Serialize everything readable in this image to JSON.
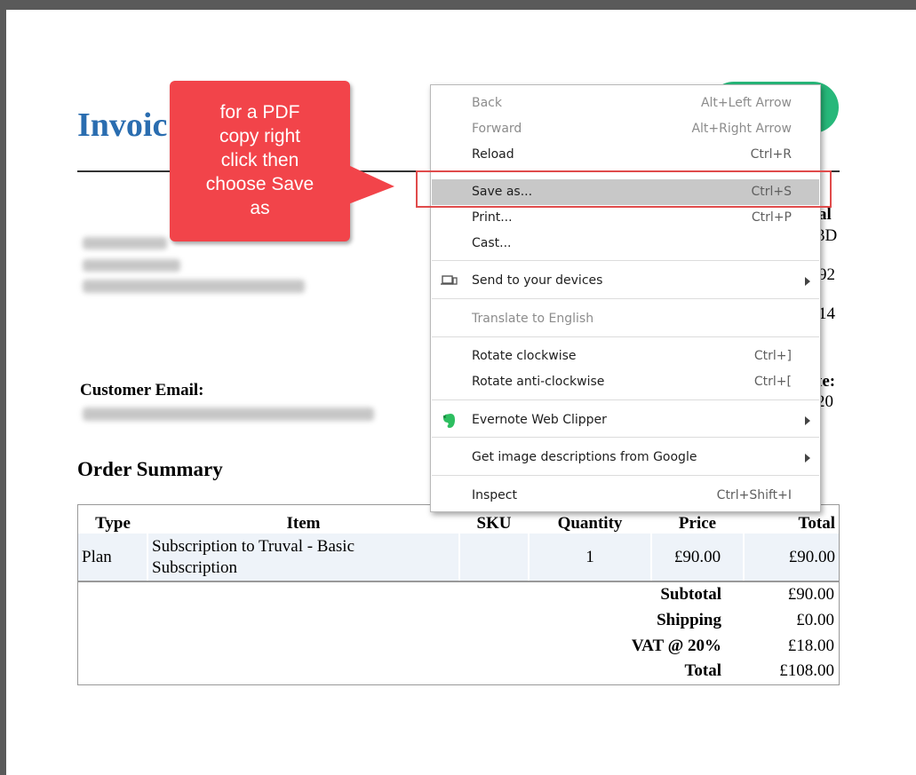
{
  "invoice": {
    "title_fragment": "Invoic",
    "right_fragments": [
      "al",
      "3D",
      "92",
      "14",
      "te:",
      "20"
    ],
    "customer_email_label": "Customer Email:",
    "order_summary_heading": "Order Summary",
    "table": {
      "headers": [
        "Type",
        "Item",
        "SKU",
        "Quantity",
        "Price",
        "Total"
      ],
      "rows": [
        {
          "type": "Plan",
          "item": "Subscription to Truval - Basic Subscription",
          "sku": "",
          "quantity": "1",
          "price": "£90.00",
          "total": "£90.00"
        }
      ]
    },
    "totals": [
      {
        "label": "Subtotal",
        "value": "£90.00"
      },
      {
        "label": "Shipping",
        "value": "£0.00"
      },
      {
        "label": "VAT @ 20%",
        "value": "£18.00"
      },
      {
        "label": "Total",
        "value": "£108.00"
      }
    ]
  },
  "callout": {
    "lines": [
      "for a PDF",
      "copy right",
      "click then",
      "choose Save",
      "as"
    ],
    "color": "#f2444a"
  },
  "context_menu": {
    "items": [
      {
        "label": "Back",
        "shortcut": "Alt+Left Arrow",
        "disabled": true
      },
      {
        "label": "Forward",
        "shortcut": "Alt+Right Arrow",
        "disabled": true
      },
      {
        "label": "Reload",
        "shortcut": "Ctrl+R"
      },
      {
        "label": "Save as...",
        "shortcut": "Ctrl+S",
        "highlighted": true
      },
      {
        "label": "Print...",
        "shortcut": "Ctrl+P"
      },
      {
        "label": "Cast..."
      },
      {
        "label": "Send to your devices",
        "icon": "devices-icon",
        "submenu": true
      },
      {
        "label": "Translate to English",
        "disabled": true
      },
      {
        "label": "Rotate clockwise",
        "shortcut": "Ctrl+]"
      },
      {
        "label": "Rotate anti-clockwise",
        "shortcut": "Ctrl+["
      },
      {
        "label": "Evernote Web Clipper",
        "icon": "evernote-icon",
        "submenu": true
      },
      {
        "label": "Get image descriptions from Google",
        "submenu": true
      },
      {
        "label": "Inspect",
        "shortcut": "Ctrl+Shift+I"
      }
    ]
  },
  "colors": {
    "invoice_title": "#2a6db0",
    "highlight_box": "#e04b4b",
    "green_button": "#27b87a"
  }
}
